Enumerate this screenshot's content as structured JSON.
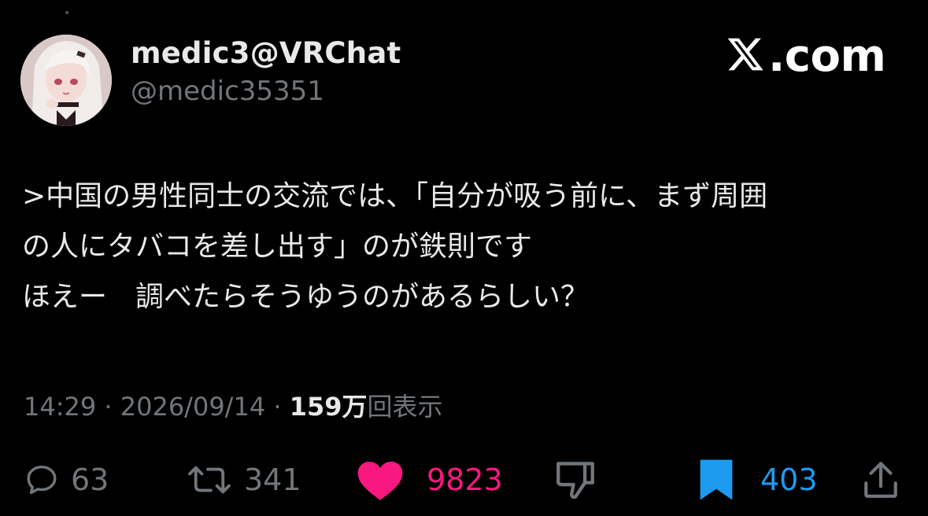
{
  "post": {
    "author": {
      "display_name": "medic3@VRChat",
      "handle": "@medic35351"
    },
    "brand": {
      "logo": "x-logo-icon",
      "text": ".com"
    },
    "text_lines": [
      ">中国の男性同士の交流では、「自分が吸う前に、まず周囲",
      "の人にタバコを差し出す」のが鉄則です",
      "ほえー　調べたらそうゆうのがあるらしい？"
    ],
    "meta": {
      "time": "14:29",
      "separator": " · ",
      "date": "2026/09/14",
      "views_count": "159",
      "views_unit": "万",
      "views_label": "回表示"
    },
    "actions": {
      "reply": {
        "icon": "reply-bubble-icon",
        "count": "63"
      },
      "repost": {
        "icon": "repost-icon",
        "count": "341"
      },
      "like": {
        "icon": "heart-icon",
        "count": "9823",
        "active": true
      },
      "dislike": {
        "icon": "thumbs-down-icon"
      },
      "bookmark": {
        "icon": "bookmark-icon",
        "count": "403",
        "active": true
      },
      "share": {
        "icon": "share-icon"
      }
    }
  },
  "colors": {
    "background": "#000000",
    "text_primary": "#e7e9ea",
    "text_secondary": "#71767b",
    "like": "#f91880",
    "bookmark": "#1d9bf0"
  }
}
